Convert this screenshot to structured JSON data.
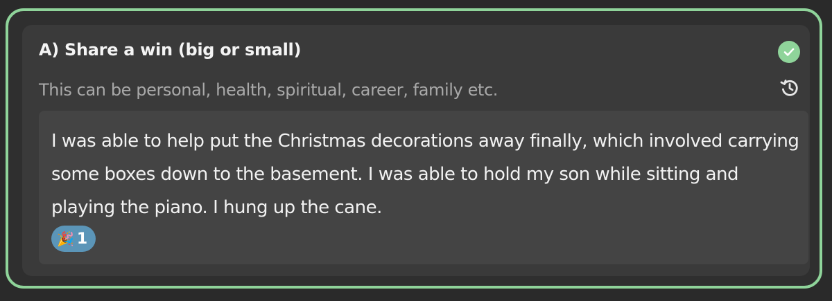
{
  "prompt": {
    "title": "A) Share a win (big or small)",
    "subtitle": "This can be personal, health, spiritual, career, family etc."
  },
  "status": {
    "icon": "check-circle-icon",
    "color": "#8fd49a"
  },
  "history": {
    "icon": "history-icon"
  },
  "answer": {
    "text": "I was able to help put the Christmas decorations away finally, which involved carrying some boxes down to the basement. I was able to hold my son while sitting and playing the piano. I hung up the cane."
  },
  "reactions": [
    {
      "emoji": "🎉",
      "icon": "party-popper-icon",
      "count": "1"
    }
  ],
  "colors": {
    "accent_border": "#8fd49a",
    "reaction_bg": "#5b95b8"
  }
}
